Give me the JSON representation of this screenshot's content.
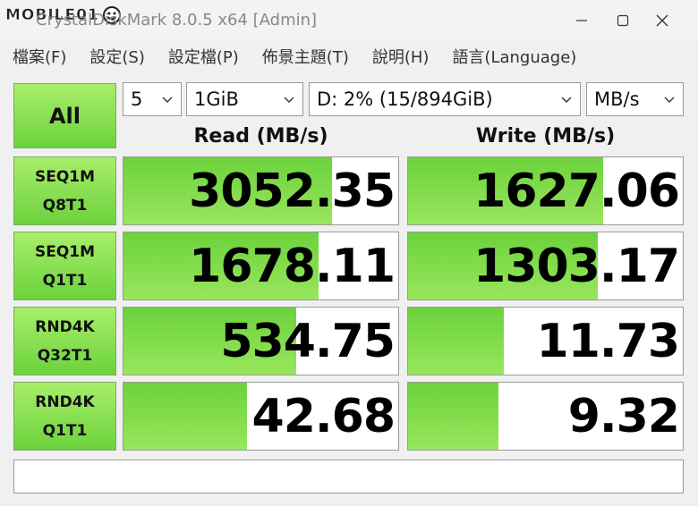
{
  "watermark": "MOBILE01",
  "window": {
    "title": "CrystalDiskMark 8.0.5 x64 [Admin]"
  },
  "menu": [
    "檔案(F)",
    "設定(S)",
    "設定檔(P)",
    "佈景主題(T)",
    "說明(H)",
    "語言(Language)"
  ],
  "controls": {
    "all_label": "All",
    "count": "5",
    "size": "1GiB",
    "drive": "D: 2% (15/894GiB)",
    "unit": "MB/s"
  },
  "headers": {
    "read": "Read (MB/s)",
    "write": "Write (MB/s)"
  },
  "tests": [
    {
      "line1": "SEQ1M",
      "line2": "Q8T1",
      "read": "3052.35",
      "write": "1627.06",
      "read_fill": 0.76,
      "write_fill": 0.71
    },
    {
      "line1": "SEQ1M",
      "line2": "Q1T1",
      "read": "1678.11",
      "write": "1303.17",
      "read_fill": 0.71,
      "write_fill": 0.69
    },
    {
      "line1": "RND4K",
      "line2": "Q32T1",
      "read": "534.75",
      "write": "11.73",
      "read_fill": 0.63,
      "write_fill": 0.35
    },
    {
      "line1": "RND4K",
      "line2": "Q1T1",
      "read": "42.68",
      "write": "9.32",
      "read_fill": 0.45,
      "write_fill": 0.33
    }
  ],
  "status": "",
  "colors": {
    "accent_green": "#6cd23c",
    "button_green": "#a8ee6a"
  }
}
